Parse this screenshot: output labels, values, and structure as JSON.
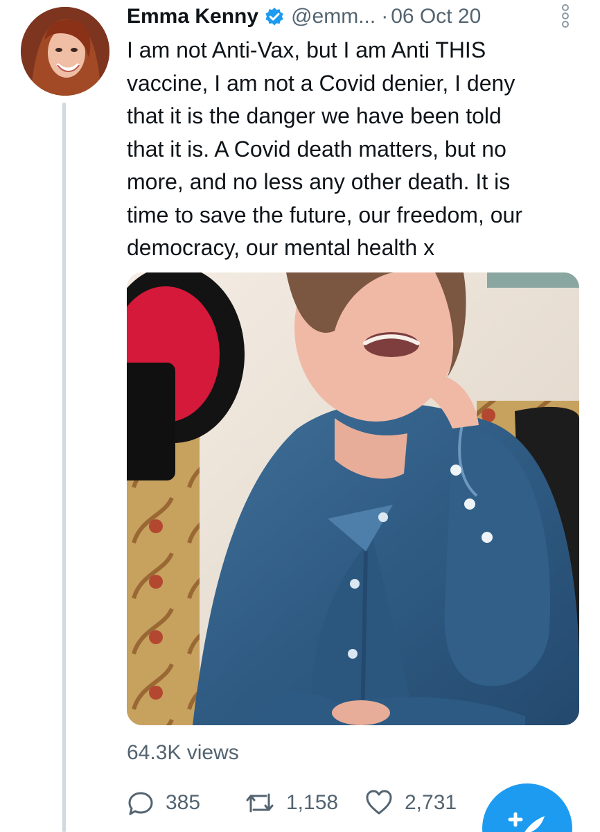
{
  "tweet": {
    "author": {
      "name": "Emma Kenny",
      "handle": "@emm...",
      "verified": true
    },
    "separator": "·",
    "date": "06 Oct 20",
    "text": "I am not Anti-Vax, but I am Anti THIS\nvaccine, I am not a Covid denier, I deny\nthat it is the danger we have been told\nthat it is. A Covid death matters, but no\nmore, and no less any other death. It is\ntime to save the future, our freedom, our\ndemocracy, our mental health x",
    "views": "64.3K views",
    "stats": {
      "replies": "385",
      "retweets": "1,158",
      "likes": "2,731"
    }
  },
  "icons": {
    "verified": "verified-badge-icon",
    "more": "more-vertical-icon",
    "reply": "reply-icon",
    "retweet": "retweet-icon",
    "like": "heart-icon",
    "compose": "compose-tweet-icon"
  },
  "colors": {
    "accent": "#1d9bf0",
    "secondary_text": "#536471",
    "thread_line": "#cfd9de"
  }
}
